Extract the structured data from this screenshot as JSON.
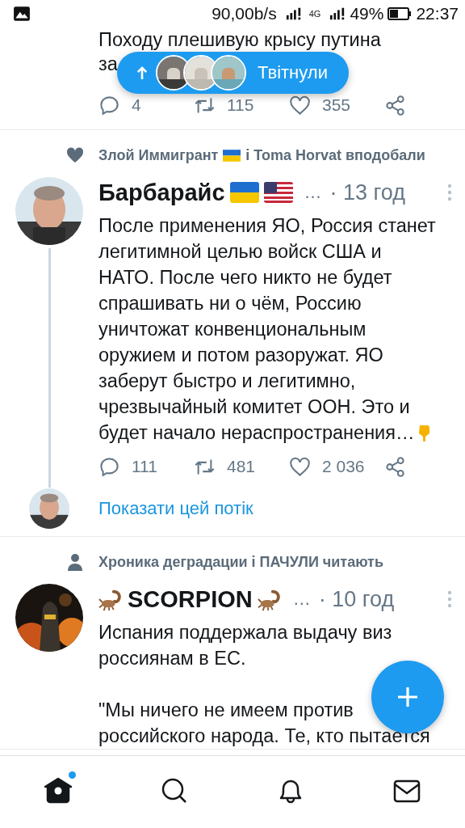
{
  "status_bar": {
    "speed": "90,00b/s",
    "network": "4G",
    "battery": "49%",
    "time": "22:37"
  },
  "new_tweets_pill": {
    "label": "Твітнули"
  },
  "tweets": [
    {
      "kind": "partial",
      "paragraphs": [
        "Походу плешивую крысу путина",
        "за"
      ],
      "actions": {
        "replies": "4",
        "retweets": "115",
        "likes": "355"
      }
    },
    {
      "kind": "full",
      "context": {
        "kind": "like",
        "text": "Злой Иммигрант",
        "flag": {
          "kind": "ua"
        },
        "text_after": "і Toma Horvat вподобали"
      },
      "name": "Барбарайс",
      "name_icons": [
        {
          "kind": "flag-ua"
        },
        {
          "kind": "flag-us"
        }
      ],
      "more": "…",
      "time": "· 13 год",
      "paragraphs": [
        "После применения ЯО, Россия станет\nлегитимной целью войск США и\nНАТО. После чего никто не будет\nспрашивать ни о чём, Россию\nуничтожат конвенциональным\nоружием и потом разоружат. ЯО\nзаберут быстро и легитимно,\nчрезвычайный комитет ООН. Это и\nбудет начало нераспространения…"
      ],
      "text_icon": {
        "kind": "point-down"
      },
      "actions": {
        "replies": "111",
        "retweets": "481",
        "likes": "2 036"
      },
      "thread": {
        "link": "Показати цей потік"
      }
    },
    {
      "kind": "full",
      "context": {
        "kind": "follow",
        "text": "Хроника деградации і ПАЧУЛИ читають"
      },
      "name_prefix_icon": {
        "kind": "scorpion"
      },
      "name": "SCORPION",
      "name_icons": [
        {
          "kind": "scorpion"
        }
      ],
      "more": "…",
      "time": "· 10 год",
      "paragraphs": [
        "Испания поддержала выдачу виз\nроссиянам в ЕС.",
        "\"Мы ничего не имеем против\nроссийского народа. Те, кто пытается"
      ]
    }
  ],
  "nav": [
    {
      "kind": "home",
      "selected": true,
      "dot": true
    },
    {
      "kind": "search",
      "selected": false,
      "dot": false
    },
    {
      "kind": "notifications",
      "selected": false,
      "dot": false
    },
    {
      "kind": "messages",
      "selected": false,
      "dot": false
    }
  ]
}
